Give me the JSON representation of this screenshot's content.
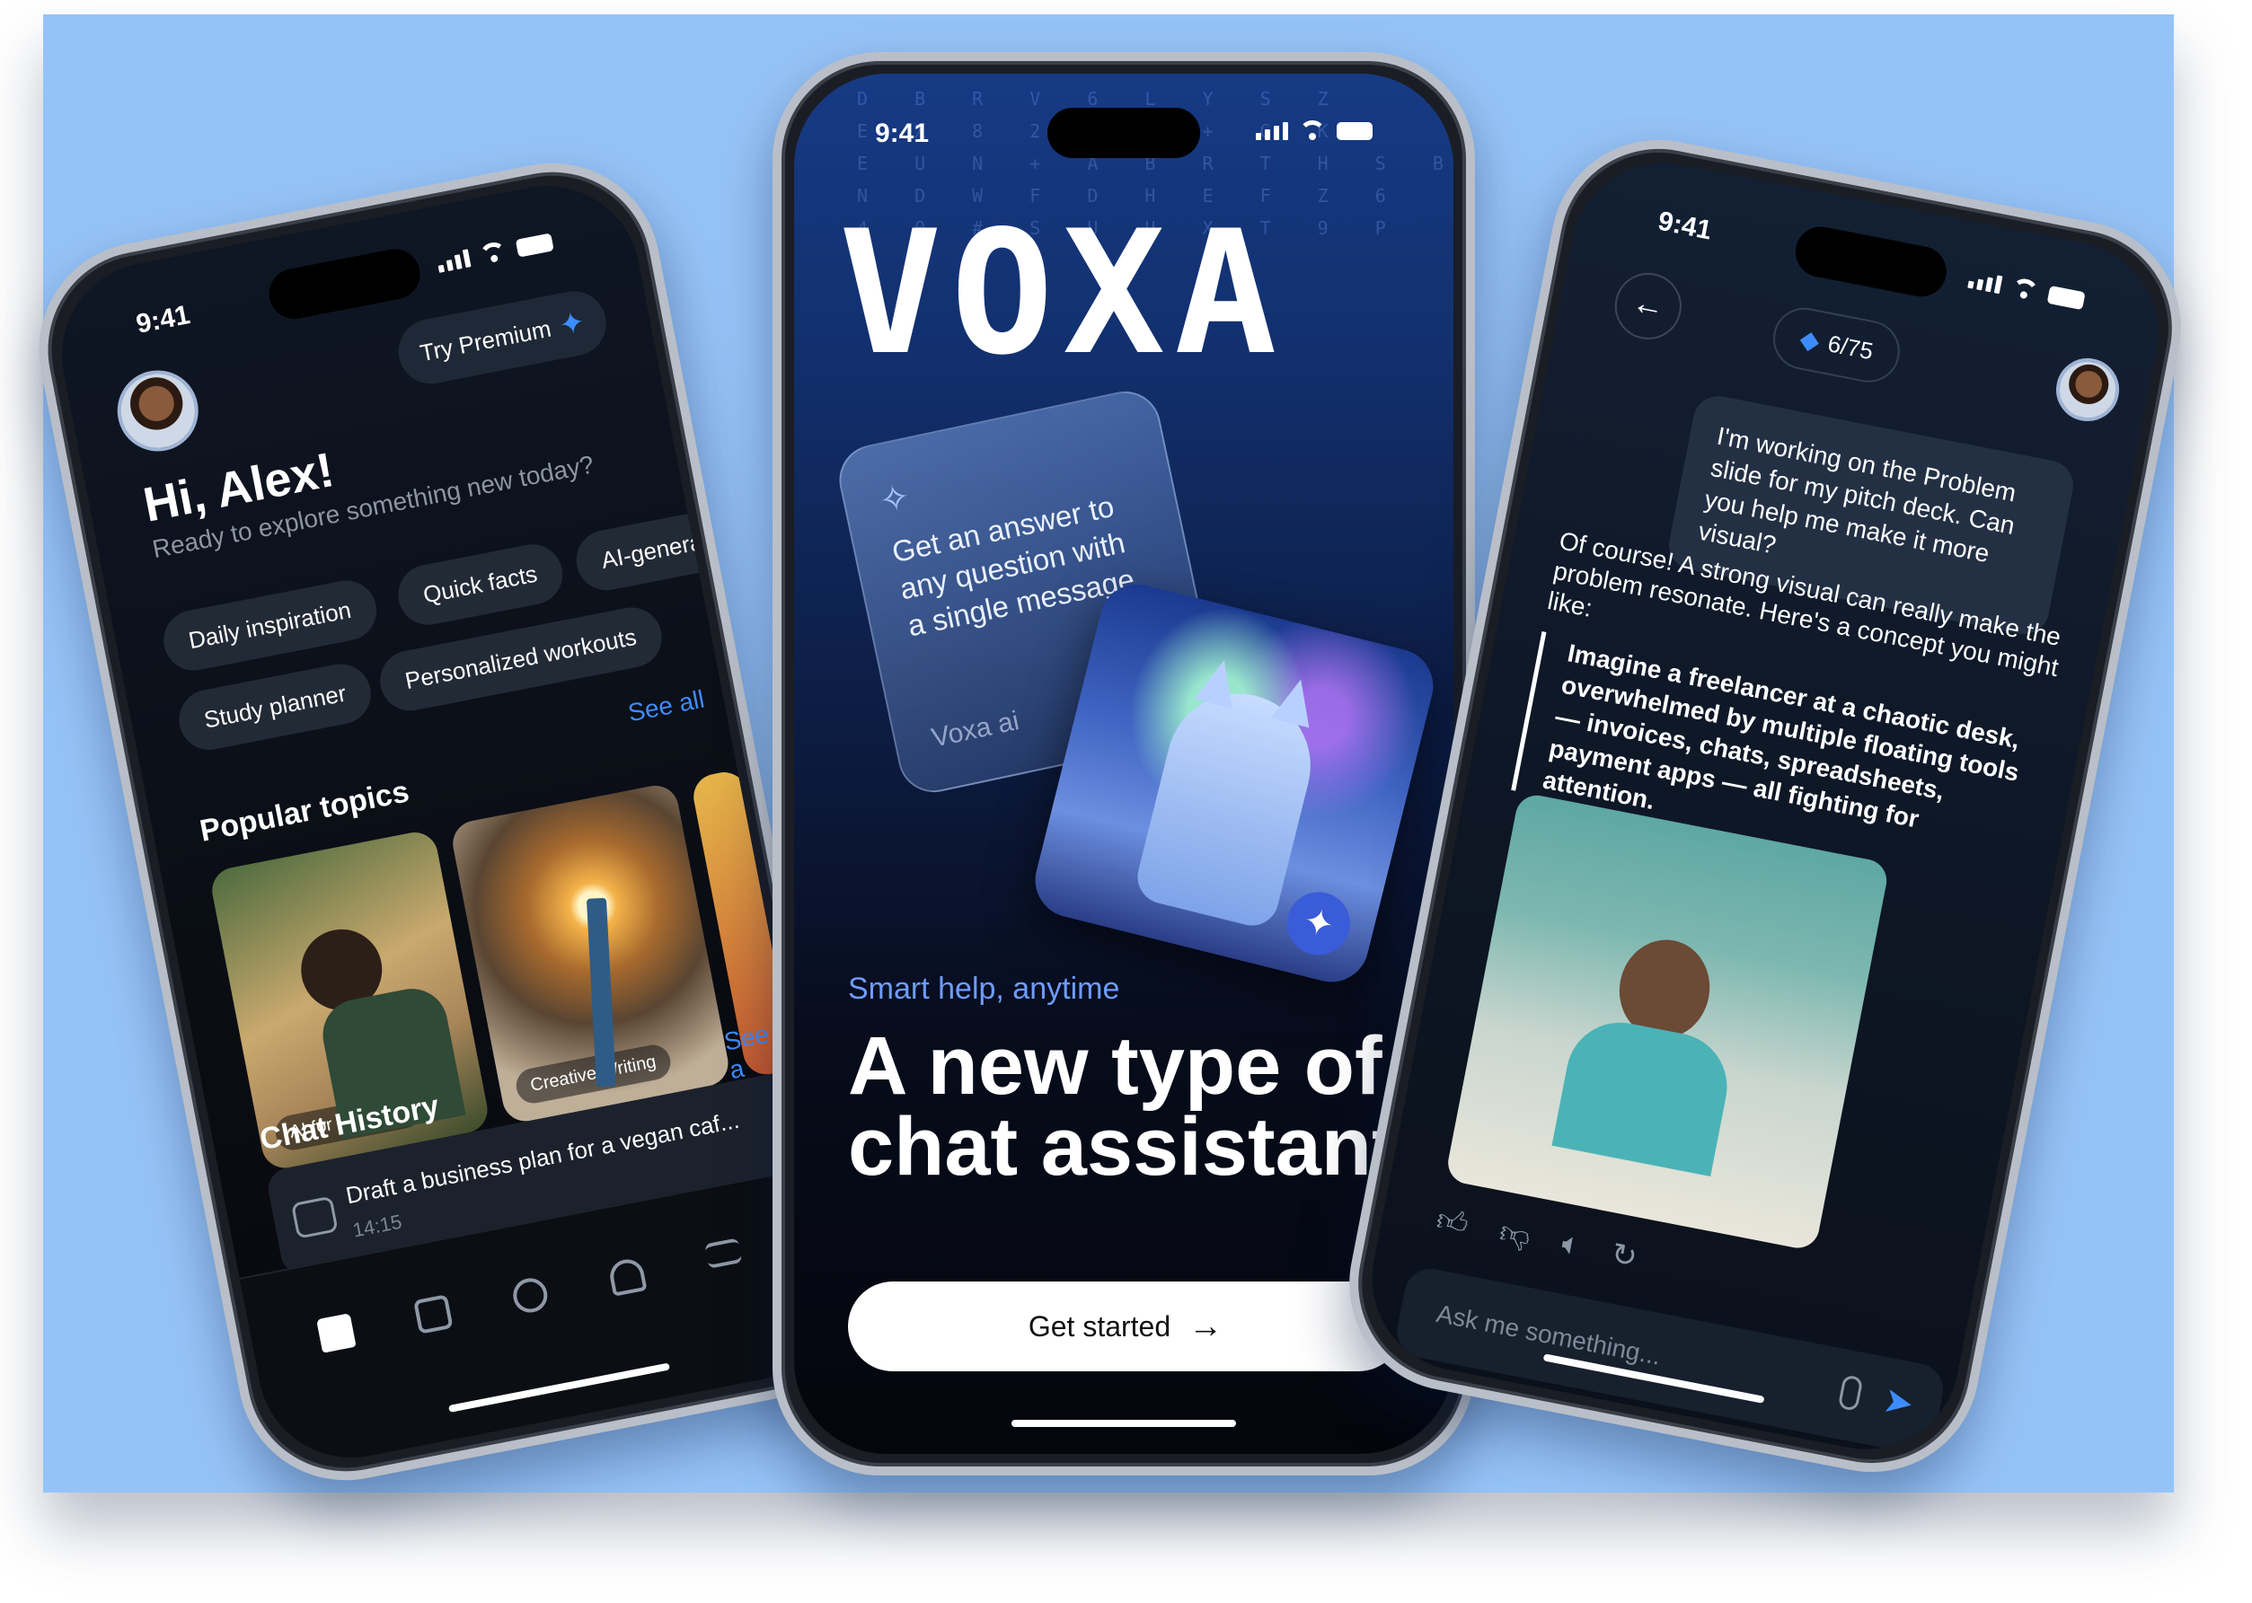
{
  "left": {
    "time": "9:41",
    "premium_label": "Try Premium",
    "greeting": "Hi, Alex!",
    "subtitle": "Ready to explore something new today?",
    "chips": [
      "Daily inspiration",
      "Quick facts",
      "AI-genera",
      "Study planner",
      "Personalized workouts"
    ],
    "see_all": "See all",
    "popular_title": "Popular topics",
    "topics": [
      "AI for Students",
      "Creative Writing"
    ],
    "see_all_2": "See a",
    "history_title": "Chat History",
    "history_item": "Draft a business plan for a vegan caf...",
    "history_time": "14:15",
    "tab_icons": [
      "home-icon",
      "folder-icon",
      "chat-icon",
      "users-icon",
      "menu-icon"
    ]
  },
  "center": {
    "time": "9:41",
    "logo": "VOXA",
    "matrix": "D B R V 6 L Y S Z\nE X 8 2 N T + G K\nE U N + A B R T H S B\nN D W F D H E F Z 6\n4 0 # S U U X T 9 P",
    "card_text": "Get an answer to any question with a single message.",
    "card_brand": "Voxa ai",
    "tagline": "Smart help, anytime",
    "headline": "A new type of chat assistant",
    "cta": "Get started",
    "arrow": "→"
  },
  "right": {
    "time": "9:41",
    "back": "←",
    "counter": "6/75",
    "user_message": "I'm working on the Problem slide for my pitch deck. Can you help me make it more visual?",
    "bot_reply": "Of course! A strong visual can really make the problem resonate. Here's a concept you might like:",
    "quote": "Imagine a freelancer at a chaotic desk, overwhelmed by multiple floating tools — invoices, chats, spreadsheets, payment apps — all fighting for attention.",
    "placeholder": "Ask me something...",
    "action_icons": [
      "thumbs-up-icon",
      "thumbs-down-icon",
      "speaker-icon",
      "refresh-icon"
    ]
  },
  "colors": {
    "background": "#96c3f7",
    "accent": "#3d8cff",
    "screen_dark": "#0a0d13"
  }
}
